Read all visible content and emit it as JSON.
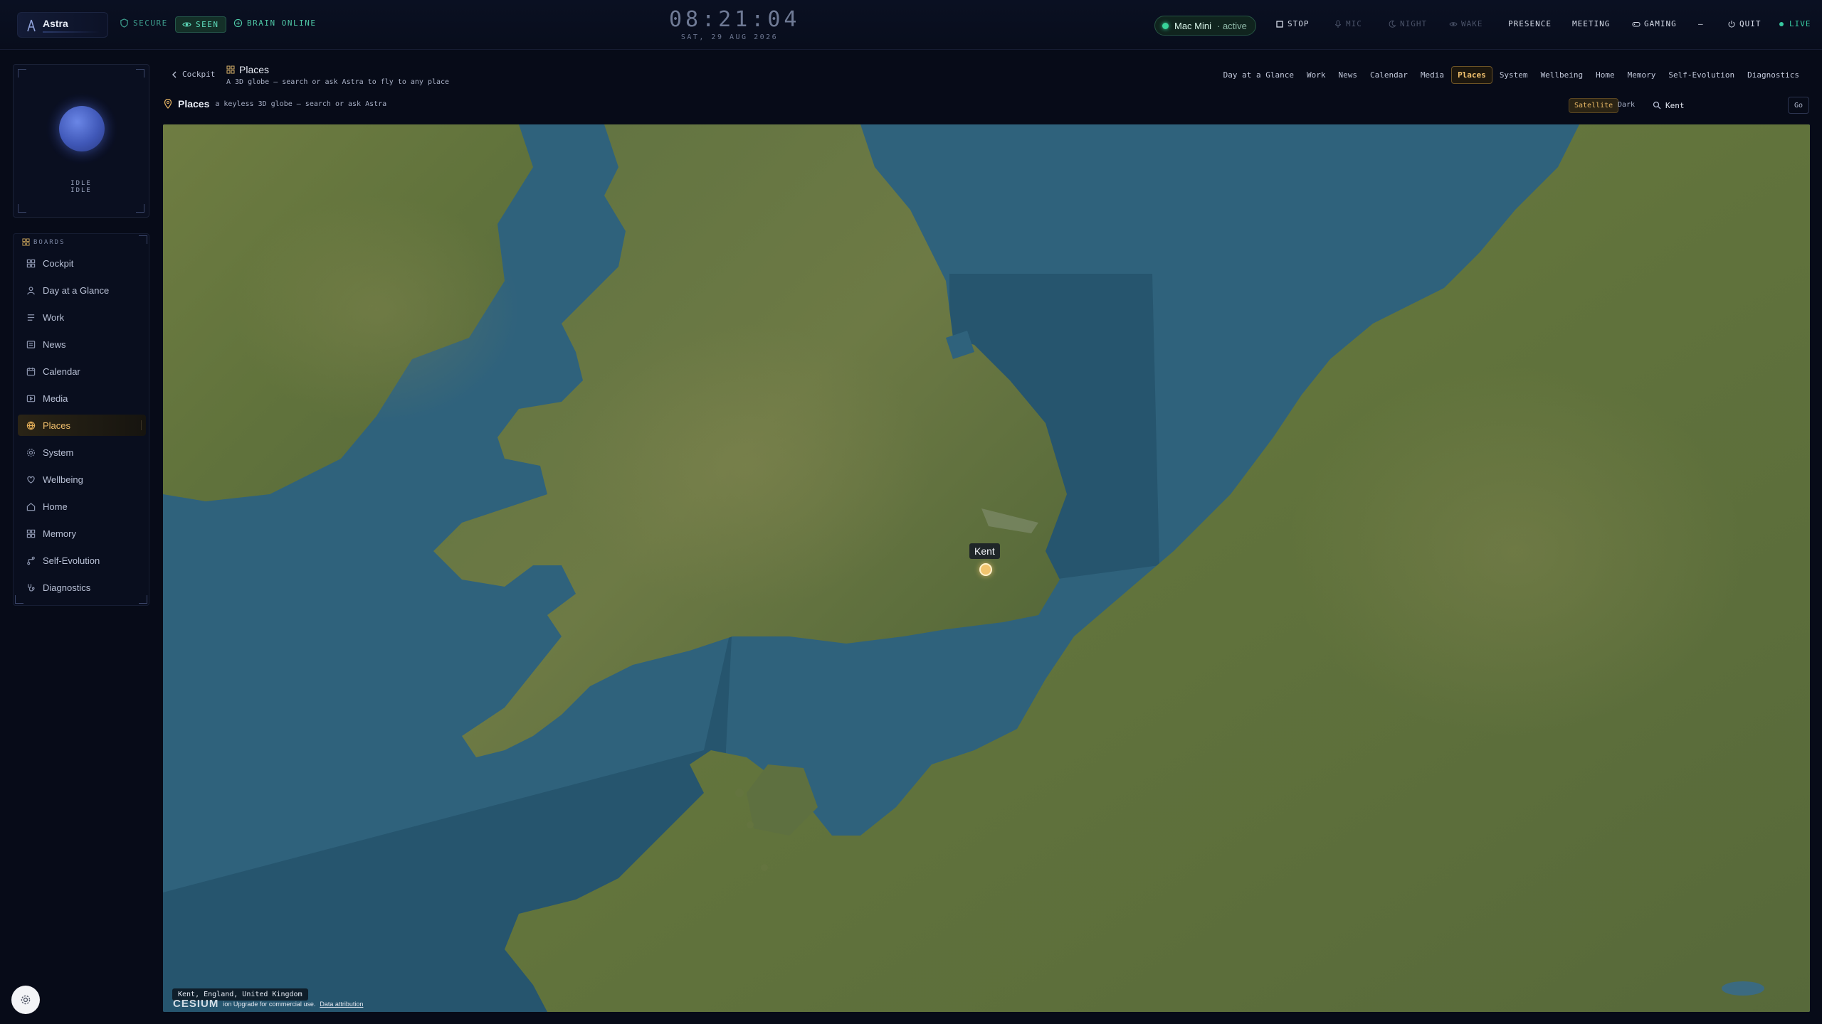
{
  "brand": {
    "name": "Astra"
  },
  "status": {
    "secure": "SECURE",
    "seen": "SEEN",
    "brain": "BRAIN ONLINE"
  },
  "clock": {
    "time": "08:21:04",
    "date": "SAT, 29 AUG 2026"
  },
  "device": {
    "name": "Mac Mini",
    "state": "· active"
  },
  "topbar_buttons": {
    "stop": "STOP",
    "mic": "MIC",
    "night": "NIGHT",
    "wake": "WAKE",
    "presence": "PRESENCE",
    "meeting": "MEETING",
    "gaming": "GAMING",
    "minimize": "—",
    "quit": "QUIT",
    "live": "LIVE"
  },
  "assistant_state": {
    "line1": "IDLE",
    "line2": "IDLE"
  },
  "sidebar": {
    "heading": "BOARDS",
    "items": [
      {
        "label": "Cockpit",
        "icon": "grid-icon"
      },
      {
        "label": "Day at a Glance",
        "icon": "person-icon"
      },
      {
        "label": "Work",
        "icon": "list-icon"
      },
      {
        "label": "News",
        "icon": "newspaper-icon"
      },
      {
        "label": "Calendar",
        "icon": "calendar-icon"
      },
      {
        "label": "Media",
        "icon": "media-icon"
      },
      {
        "label": "Places",
        "icon": "globe-icon",
        "active": true
      },
      {
        "label": "System",
        "icon": "cpu-icon"
      },
      {
        "label": "Wellbeing",
        "icon": "heart-icon"
      },
      {
        "label": "Home",
        "icon": "home-icon"
      },
      {
        "label": "Memory",
        "icon": "grid-icon"
      },
      {
        "label": "Self-Evolution",
        "icon": "branch-icon"
      },
      {
        "label": "Diagnostics",
        "icon": "stethoscope-icon"
      }
    ]
  },
  "header": {
    "back_label": "Cockpit",
    "title": "Places",
    "subtitle": "A 3D globe — search or ask Astra to fly to any place"
  },
  "tabs": [
    "Day at a Glance",
    "Work",
    "News",
    "Calendar",
    "Media",
    "Places",
    "System",
    "Wellbeing",
    "Home",
    "Memory",
    "Self-Evolution",
    "Diagnostics"
  ],
  "active_tab": "Places",
  "section": {
    "title": "Places",
    "subtitle": "a keyless 3D globe — search or ask Astra",
    "style_satellite": "Satellite",
    "style_dark": "Dark",
    "search_value": "Kent",
    "go_label": "Go"
  },
  "map": {
    "marker_label": "Kent",
    "place_readout": "Kent, England, United Kingdom",
    "attribution_logo": "CESIUM",
    "attribution_text": "ion Upgrade for commercial use.",
    "attribution_link": "Data attribution"
  },
  "colors": {
    "accent": "#f2c06d",
    "live": "#37c9a0",
    "background": "#070b18",
    "ocean": "#2d5f7a",
    "land": "#6b7b3e"
  }
}
